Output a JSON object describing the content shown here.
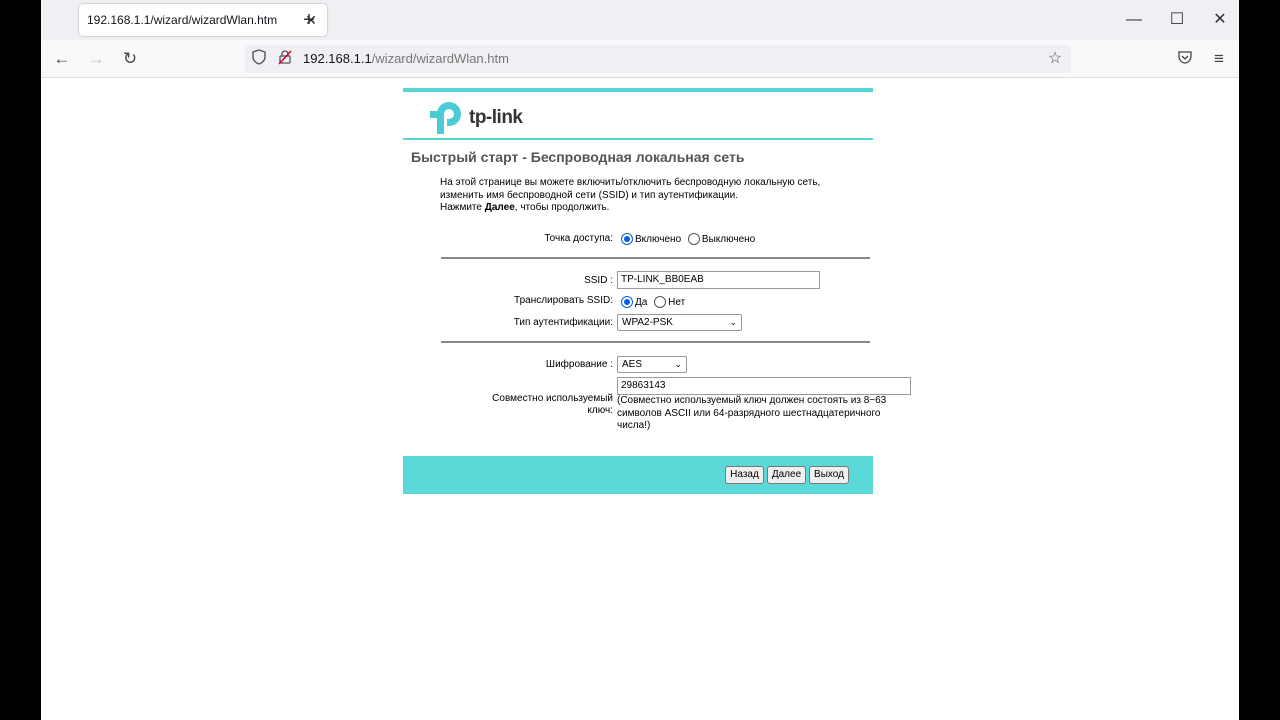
{
  "browser": {
    "tab_title": "192.168.1.1/wizard/wizardWlan.htm",
    "url_host": "192.168.1.1",
    "url_path": "/wizard/wizardWlan.htm"
  },
  "page": {
    "logo_text": "tp-link",
    "title": "Быстрый старт - Беспроводная локальная сеть",
    "desc_line1": "На этой странице вы можете включить/отключить беспроводную локальную сеть,",
    "desc_line2": "изменить имя беспроводной сети (SSID) и тип аутентификации.",
    "desc_line3_pre": "Нажмите ",
    "desc_line3_bold": "Далее",
    "desc_line3_post": ", чтобы продолжить."
  },
  "form": {
    "ap_label": "Точка доступа:",
    "ap_on": "Включено",
    "ap_off": "Выключено",
    "ssid_label": "SSID :",
    "ssid_value": "TP-LINK_BB0EAB",
    "broadcast_label": "Транслировать SSID:",
    "broadcast_yes": "Да",
    "broadcast_no": "Нет",
    "auth_label": "Тип аутентификации:",
    "auth_value": "WPA2-PSK",
    "enc_label": "Шифрование :",
    "enc_value": "AES",
    "key_label_1": "Совместно используемый",
    "key_label_2": "ключ:",
    "key_value": "29863143",
    "key_note": "(Совместно используемый ключ должен состоять из 8~63 символов ASCII или 64-разрядного шестнадцатеричного числа!)"
  },
  "buttons": {
    "back": "Назад",
    "next": "Далее",
    "exit": "Выход"
  },
  "colors": {
    "accent": "#55d6d6"
  }
}
